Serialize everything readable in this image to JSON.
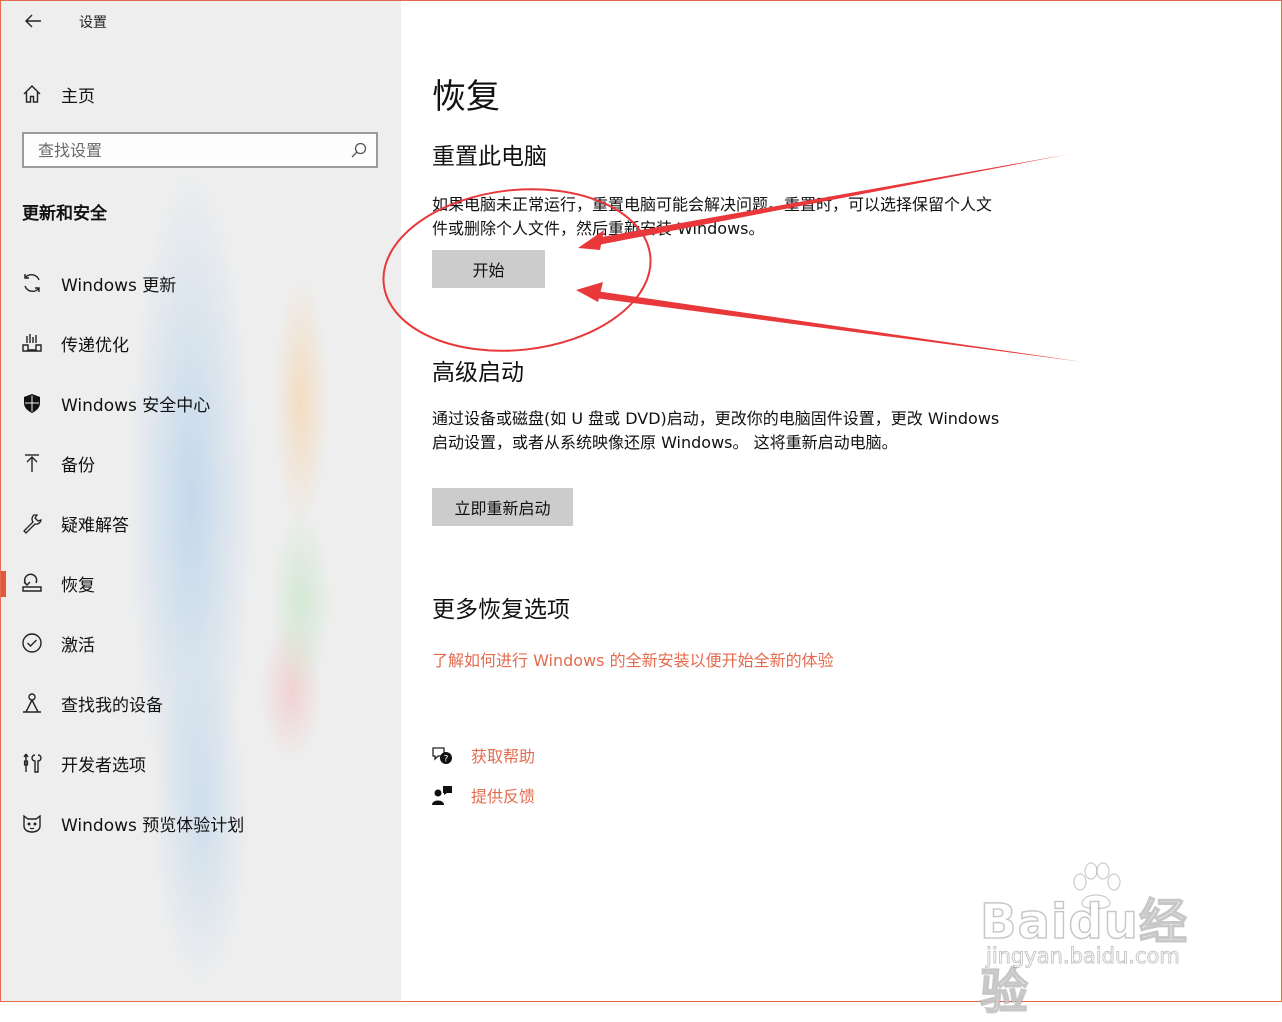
{
  "window": {
    "title": "设置",
    "back_icon": "arrow-left-icon",
    "controls": {
      "minimize_icon": "minimize-icon",
      "maximize_icon": "maximize-icon",
      "close_icon": "close-icon"
    }
  },
  "sidebar": {
    "home_label": "主页",
    "search_placeholder": "查找设置",
    "section_title": "更新和安全",
    "items": [
      {
        "label": "Windows 更新",
        "icon": "sync-icon"
      },
      {
        "label": "传递优化",
        "icon": "delivery-optimization-icon"
      },
      {
        "label": "Windows 安全中心",
        "icon": "shield-icon"
      },
      {
        "label": "备份",
        "icon": "backup-arrow-icon"
      },
      {
        "label": "疑难解答",
        "icon": "wrench-icon"
      },
      {
        "label": "恢复",
        "icon": "recovery-icon",
        "selected": true
      },
      {
        "label": "激活",
        "icon": "check-circle-icon"
      },
      {
        "label": "查找我的设备",
        "icon": "find-device-icon"
      },
      {
        "label": "开发者选项",
        "icon": "developer-tools-icon"
      },
      {
        "label": "Windows 预览体验计划",
        "icon": "insider-cat-icon"
      }
    ]
  },
  "main": {
    "title": "恢复",
    "reset": {
      "heading": "重置此电脑",
      "description": "如果电脑未正常运行，重置电脑可能会解决问题。重置时，可以选择保留个人文件或删除个人文件，然后重新安装 Windows。",
      "button_label": "开始"
    },
    "advanced": {
      "heading": "高级启动",
      "description": "通过设备或磁盘(如 U 盘或 DVD)启动，更改你的电脑固件设置，更改 Windows 启动设置，或者从系统映像还原 Windows。 这将重新启动电脑。",
      "button_label": "立即重新启动"
    },
    "more": {
      "heading": "更多恢复选项",
      "link": "了解如何进行 Windows 的全新安装以便开始全新的体验"
    },
    "help": {
      "get_help": "获取帮助",
      "feedback": "提供反馈"
    }
  },
  "watermark": {
    "brand": "Baidu经验",
    "url": "jingyan.baidu.com"
  },
  "colors": {
    "accent": "#e46b4e",
    "annotation_red": "#e8383a",
    "button_bg": "#cccccc",
    "sidebar_bg": "#eeeeee"
  }
}
